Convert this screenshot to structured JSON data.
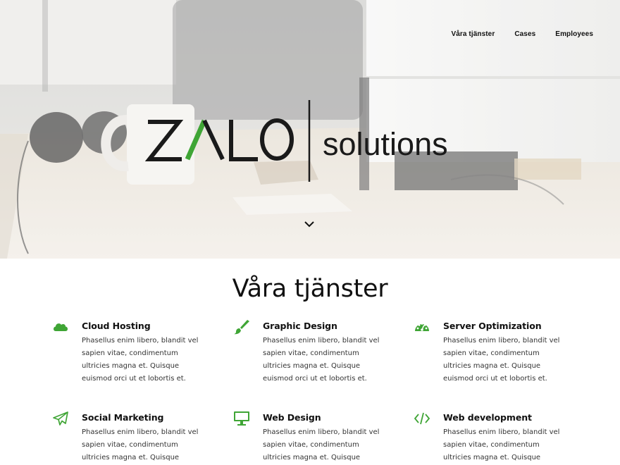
{
  "nav": {
    "items": [
      "Våra tjänster",
      "Cases",
      "Employees"
    ]
  },
  "logo": {
    "brand": "ZALO",
    "tagline": "solutions",
    "accent_color": "#3fa535"
  },
  "services": {
    "title": "Våra tjänster",
    "items": [
      {
        "title": "Cloud Hosting",
        "icon": "cloud-icon",
        "text": "Phasellus enim libero, blandit vel sapien vitae, condimentum ultricies magna et. Quisque euismod orci ut et lobortis et."
      },
      {
        "title": "Graphic Design",
        "icon": "paintbrush-icon",
        "text": "Phasellus enim libero, blandit vel sapien vitae, condimentum ultricies magna et. Quisque euismod orci ut et lobortis et."
      },
      {
        "title": "Server Optimization",
        "icon": "dashboard-icon",
        "text": "Phasellus enim libero, blandit vel sapien vitae, condimentum ultricies magna et. Quisque euismod orci ut et lobortis et."
      },
      {
        "title": "Social Marketing",
        "icon": "paper-plane-icon",
        "text": "Phasellus enim libero, blandit vel sapien vitae, condimentum ultricies magna et. Quisque euismod orci ut et"
      },
      {
        "title": "Web Design",
        "icon": "desktop-icon",
        "text": "Phasellus enim libero, blandit vel sapien vitae, condimentum ultricies magna et. Quisque euismod orci ut et"
      },
      {
        "title": "Web development",
        "icon": "code-icon",
        "text": "Phasellus enim libero, blandit vel sapien vitae, condimentum ultricies magna et. Quisque euismod orci ut et"
      }
    ]
  },
  "colors": {
    "accent": "#3fa535",
    "text": "#111111"
  }
}
